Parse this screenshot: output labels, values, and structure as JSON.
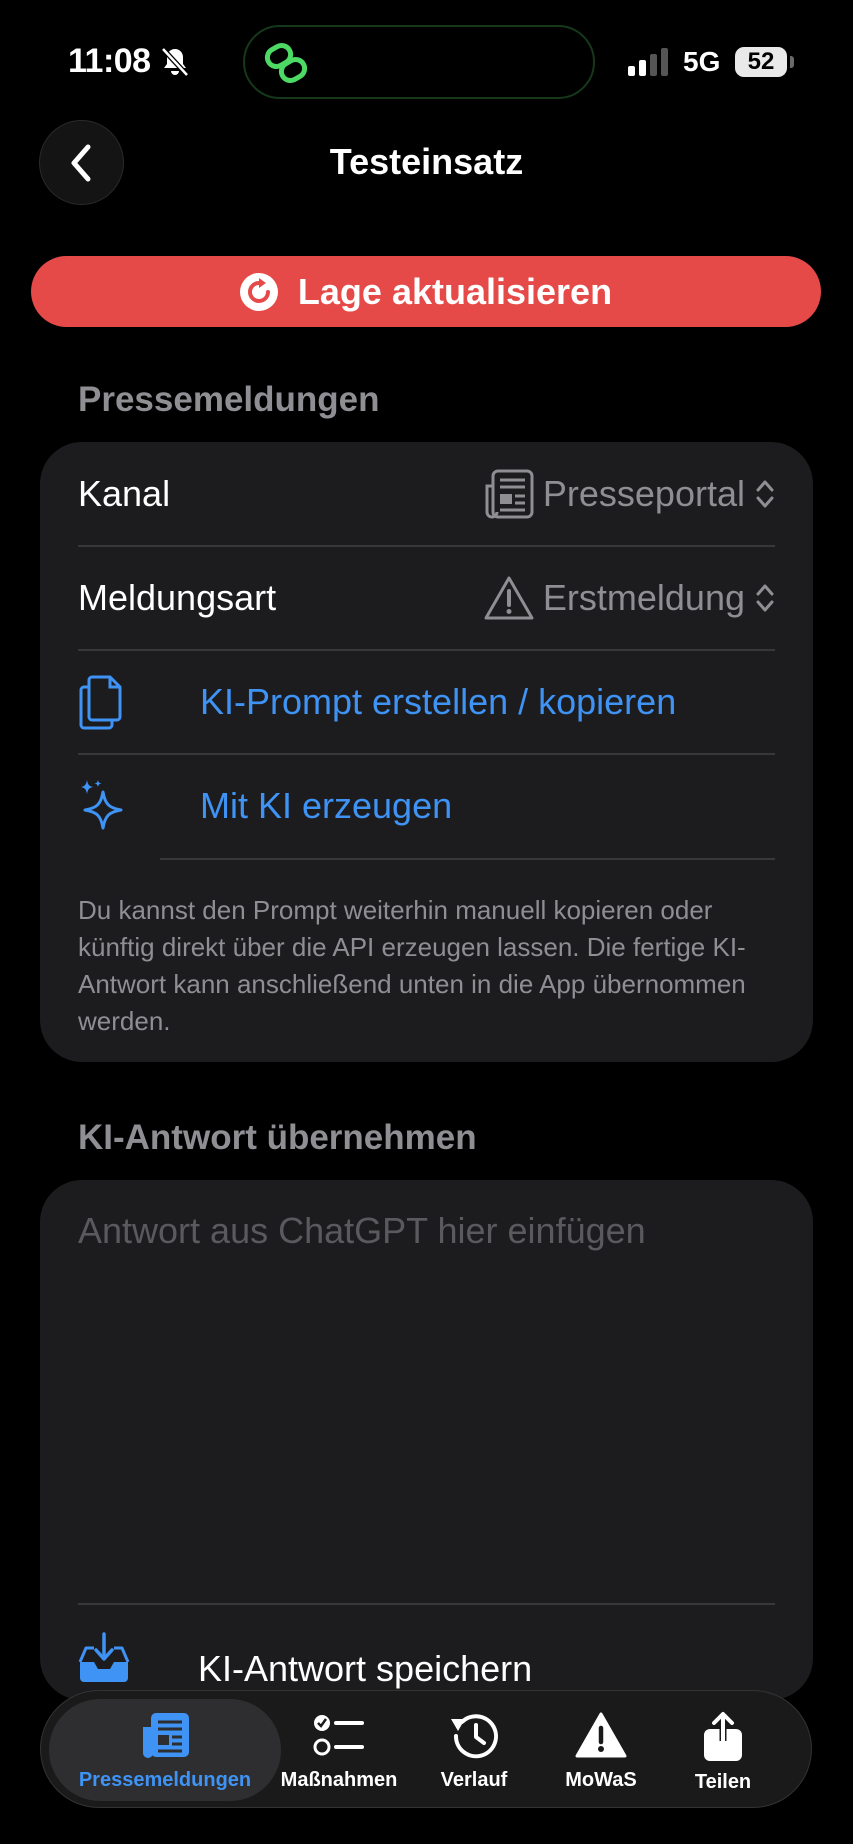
{
  "status_bar": {
    "time": "11:08",
    "network": "5G",
    "battery": "52"
  },
  "nav": {
    "title": "Testeinsatz"
  },
  "refresh_button": {
    "label": "Lage aktualisieren",
    "color": "#e64a48"
  },
  "press_section": {
    "header": "Pressemeldungen",
    "channel": {
      "label": "Kanal",
      "value": "Presseportal",
      "icon": "newspaper-icon"
    },
    "message_type": {
      "label": "Meldungsart",
      "value": "Erstmeldung",
      "icon": "warning-triangle-icon"
    },
    "prompt_action": {
      "label": "KI-Prompt erstellen / kopieren",
      "icon": "documents-icon"
    },
    "generate_action": {
      "label": "Mit KI erzeugen",
      "icon": "sparkles-icon"
    },
    "footnote": "Du kannst den Prompt weiterhin manuell kopieren oder künftig direkt über die API erzeugen lassen. Die fertige KI-Antwort kann anschließend unten in die App übernommen werden."
  },
  "ai_section": {
    "header": "KI-Antwort übernehmen",
    "input_placeholder": "Antwort aus ChatGPT hier einfügen",
    "save_label": "KI-Antwort speichern",
    "save_icon": "tray-download-icon"
  },
  "tab_bar": {
    "tabs": [
      {
        "label": "Pressemeldungen",
        "icon": "newspaper-icon",
        "active": true
      },
      {
        "label": "Maßnahmen",
        "icon": "checklist-icon",
        "active": false
      },
      {
        "label": "Verlauf",
        "icon": "history-icon",
        "active": false
      },
      {
        "label": "MoWaS",
        "icon": "warning-icon",
        "active": false
      },
      {
        "label": "Teilen",
        "icon": "share-icon",
        "active": false
      }
    ]
  },
  "colors": {
    "accent": "#3e93f4",
    "card": "#1c1c1e",
    "secondary_text": "#8e8e93"
  }
}
